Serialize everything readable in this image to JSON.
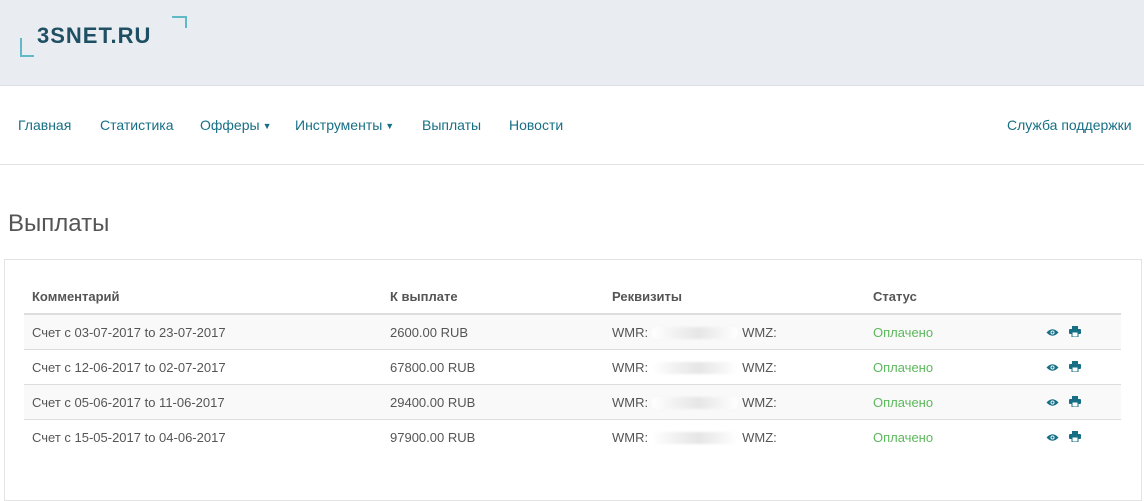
{
  "brand": {
    "logo_text": "3SNET.RU",
    "accent": "#176f86",
    "status_color": "#5cb85c"
  },
  "nav": {
    "items": [
      {
        "label": "Главная",
        "dropdown": false
      },
      {
        "label": "Статистика",
        "dropdown": false
      },
      {
        "label": "Офферы",
        "dropdown": true
      },
      {
        "label": "Инструменты",
        "dropdown": true
      },
      {
        "label": "Выплаты",
        "dropdown": false
      },
      {
        "label": "Новости",
        "dropdown": false
      }
    ],
    "support": "Служба поддержки"
  },
  "page": {
    "title": "Выплаты"
  },
  "payouts": {
    "headers": [
      "Комментарий",
      "К выплате",
      "Реквизиты",
      "Статус"
    ],
    "rows": [
      {
        "comment": "Счет с 03-07-2017 to 23-07-2017",
        "amount": "2600.00 RUB",
        "wmr": "WMR:",
        "wmz": "WMZ:",
        "status": "Оплачено"
      },
      {
        "comment": "Счет с 12-06-2017 to 02-07-2017",
        "amount": "67800.00 RUB",
        "wmr": "WMR:",
        "wmz": "WMZ:",
        "status": "Оплачено"
      },
      {
        "comment": "Счет с 05-06-2017 to 11-06-2017",
        "amount": "29400.00 RUB",
        "wmr": "WMR:",
        "wmz": "WMZ:",
        "status": "Оплачено"
      },
      {
        "comment": "Счет с 15-05-2017 to 04-06-2017",
        "amount": "97900.00 RUB",
        "wmr": "WMR:",
        "wmz": "WMZ:",
        "status": "Оплачено"
      }
    ],
    "row_actions": [
      "eye-icon",
      "print-icon"
    ]
  }
}
